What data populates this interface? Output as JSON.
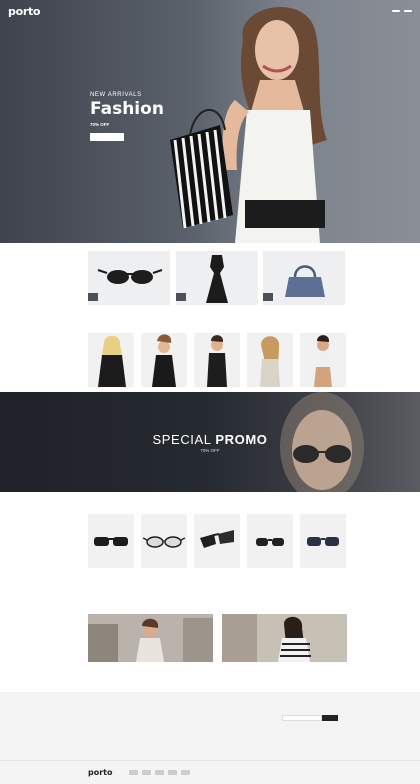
{
  "header": {
    "logo": "porto",
    "logo_sub": "",
    "nav": [
      "",
      "",
      "",
      ""
    ],
    "right": [
      "",
      "",
      "",
      ""
    ]
  },
  "hero": {
    "kicker": "New Arrivals",
    "title": "Fashion",
    "sub_bold": "70% OFF",
    "sub_rest": "",
    "button": ""
  },
  "categories": [
    {
      "label": ""
    },
    {
      "label": ""
    },
    {
      "label": ""
    }
  ],
  "featured": {
    "title": "",
    "products": [
      {
        "name": "",
        "stars": "",
        "price": ""
      },
      {
        "name": "",
        "stars": "",
        "price": ""
      },
      {
        "name": "",
        "stars": "",
        "price": ""
      },
      {
        "name": "",
        "stars": "",
        "price": ""
      },
      {
        "name": "",
        "stars": "",
        "price": ""
      }
    ]
  },
  "promo": {
    "title_light": "SPECIAL",
    "title_bold": "PROMO",
    "sub": "70% OFF",
    "button": ""
  },
  "new_arrivals": {
    "title": "",
    "products": [
      {
        "name": "",
        "stars": "",
        "price": ""
      },
      {
        "name": "",
        "stars": "",
        "price": ""
      },
      {
        "name": "",
        "stars": "",
        "price": ""
      },
      {
        "name": "",
        "stars": "",
        "price": ""
      },
      {
        "name": "",
        "stars": "",
        "price": ""
      }
    ]
  },
  "blog": {
    "title": "",
    "posts": [
      {
        "meta": "",
        "title": ""
      },
      {
        "meta": "",
        "title": ""
      }
    ]
  },
  "footer": {
    "cols": [
      {
        "title": "",
        "items": [
          "",
          "",
          "",
          ""
        ]
      },
      {
        "title": "",
        "items": [
          "",
          "",
          ""
        ]
      },
      {
        "title": "",
        "items": [
          "",
          ""
        ]
      },
      {
        "title": "",
        "items": [
          ""
        ],
        "button": ""
      }
    ],
    "logo": "porto",
    "copyright": ""
  }
}
